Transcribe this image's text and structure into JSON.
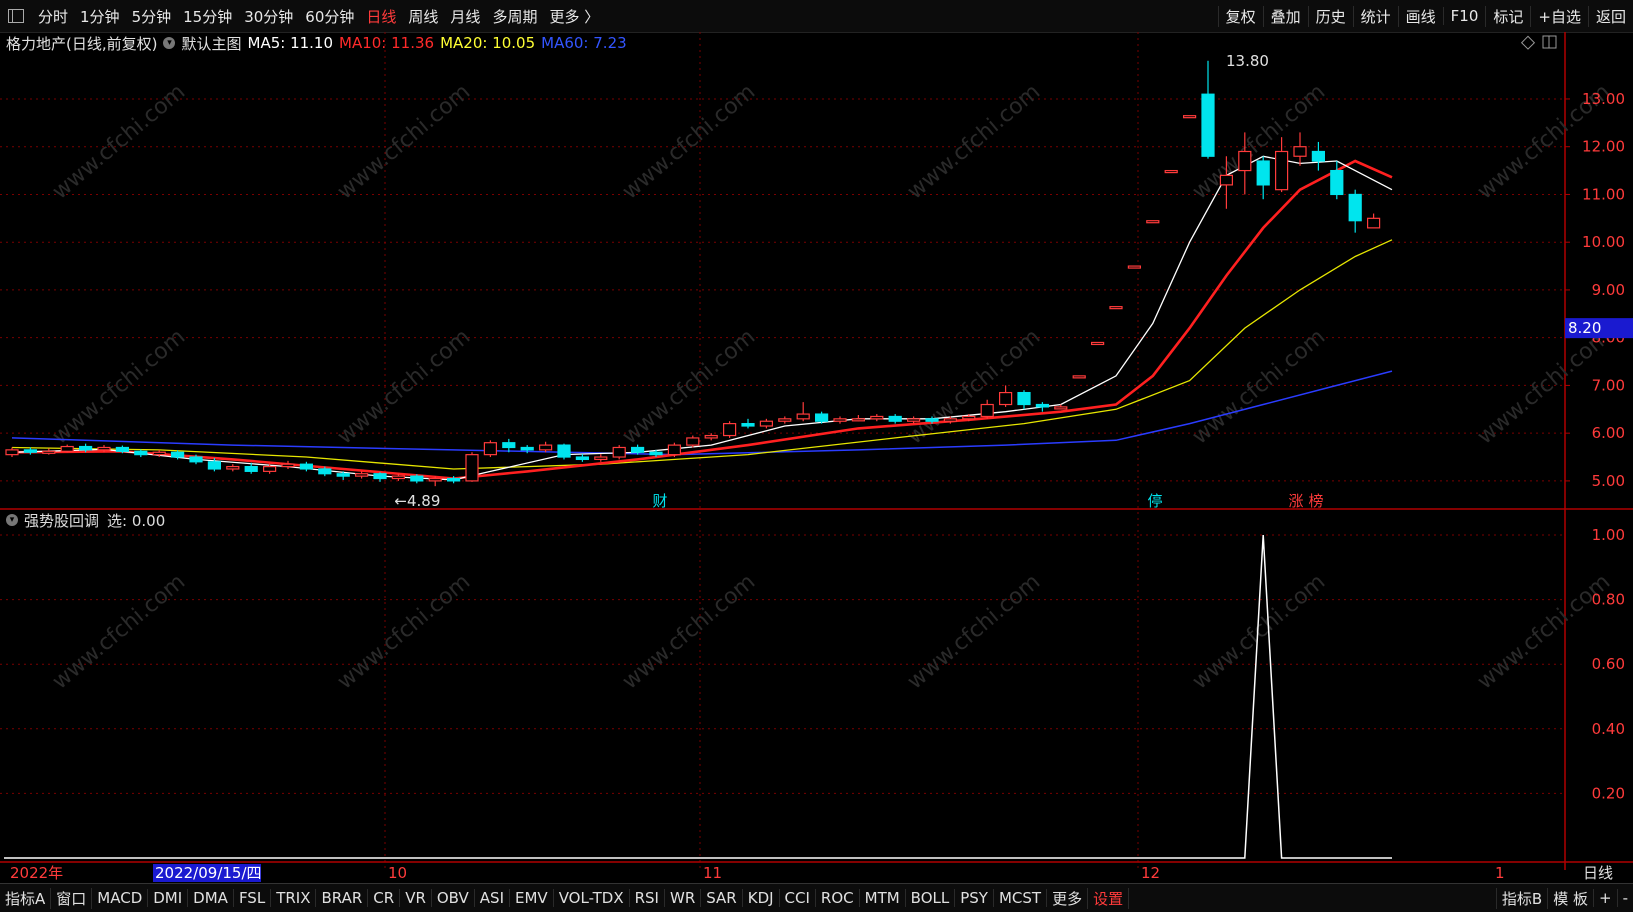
{
  "topbar": {
    "periods": [
      "分时",
      "1分钟",
      "5分钟",
      "15分钟",
      "30分钟",
      "60分钟",
      "日线",
      "周线",
      "月线",
      "多周期",
      "更多 〉"
    ],
    "active_period": "日线",
    "tools": [
      "复权",
      "叠加",
      "历史",
      "统计",
      "画线",
      "F10",
      "标记",
      "+自选",
      "返回"
    ]
  },
  "legend": {
    "title": "格力地产(日线,前复权)",
    "template": "默认主图",
    "ma5": "MA5: 11.10",
    "ma10": "MA10: 11.36",
    "ma20": "MA20: 10.05",
    "ma60": "MA60: 7.23"
  },
  "sub_legend": {
    "title": "强势股回调",
    "value": "选: 0.00"
  },
  "price_axis": {
    "ticks": [
      "13.00",
      "12.00",
      "11.00",
      "10.00",
      "9.00",
      "8.00",
      "7.00",
      "6.00",
      "5.00"
    ],
    "current": "8.20"
  },
  "sub_axis": {
    "ticks": [
      "1.00",
      "0.80",
      "0.60",
      "0.40",
      "0.20"
    ]
  },
  "annotations": {
    "high": "13.80",
    "low": "←4.89",
    "markers": [
      "财",
      "停",
      "涨",
      "榜"
    ]
  },
  "time_axis": {
    "labels": [
      "2022年",
      "2022/09/15/四",
      "10",
      "11",
      "12",
      "1"
    ],
    "period_label": "日线"
  },
  "bottom_tabs": [
    "指标A",
    "窗口",
    "MACD",
    "DMI",
    "DMA",
    "FSL",
    "TRIX",
    "BRAR",
    "CR",
    "VR",
    "OBV",
    "ASI",
    "EMV",
    "VOL-TDX",
    "RSI",
    "WR",
    "SAR",
    "KDJ",
    "CCI",
    "ROC",
    "MTM",
    "BOLL",
    "PSY",
    "MCST",
    "更多",
    "设置"
  ],
  "bottom_right": [
    "指标B",
    "模 板",
    "+",
    "-"
  ],
  "watermark": "www.cfchi.com",
  "colors": {
    "up": "#ff3b3b",
    "down": "#00e5ee",
    "ma5": "#ffffff",
    "ma10": "#ff2020",
    "ma20": "#e6e600",
    "ma60": "#2a3cff",
    "grid": "#7a0000",
    "axis_line": "#b00000"
  },
  "chart_data": {
    "type": "candlestick",
    "price_range": [
      4.6,
      13.9
    ],
    "candles": [
      [
        5.55,
        5.65,
        5.7,
        5.5
      ],
      [
        5.65,
        5.6,
        5.7,
        5.55
      ],
      [
        5.6,
        5.62,
        5.68,
        5.55
      ],
      [
        5.62,
        5.72,
        5.76,
        5.6
      ],
      [
        5.72,
        5.65,
        5.78,
        5.6
      ],
      [
        5.65,
        5.7,
        5.75,
        5.6
      ],
      [
        5.7,
        5.62,
        5.74,
        5.58
      ],
      [
        5.62,
        5.55,
        5.66,
        5.5
      ],
      [
        5.55,
        5.6,
        5.65,
        5.5
      ],
      [
        5.6,
        5.5,
        5.64,
        5.45
      ],
      [
        5.5,
        5.4,
        5.55,
        5.35
      ],
      [
        5.4,
        5.25,
        5.48,
        5.2
      ],
      [
        5.25,
        5.3,
        5.35,
        5.2
      ],
      [
        5.3,
        5.2,
        5.38,
        5.15
      ],
      [
        5.2,
        5.3,
        5.36,
        5.15
      ],
      [
        5.3,
        5.35,
        5.42,
        5.25
      ],
      [
        5.35,
        5.25,
        5.4,
        5.2
      ],
      [
        5.25,
        5.15,
        5.3,
        5.1
      ],
      [
        5.15,
        5.1,
        5.2,
        5.02
      ],
      [
        5.1,
        5.15,
        5.2,
        5.05
      ],
      [
        5.15,
        5.05,
        5.18,
        4.98
      ],
      [
        5.05,
        5.1,
        5.15,
        5.0
      ],
      [
        5.1,
        5.0,
        5.14,
        4.95
      ],
      [
        5.0,
        5.05,
        5.1,
        4.89
      ],
      [
        5.05,
        5.0,
        5.1,
        4.95
      ],
      [
        5.0,
        5.55,
        5.6,
        4.98
      ],
      [
        5.55,
        5.8,
        5.85,
        5.5
      ],
      [
        5.8,
        5.7,
        5.88,
        5.6
      ],
      [
        5.7,
        5.65,
        5.75,
        5.58
      ],
      [
        5.65,
        5.75,
        5.82,
        5.6
      ],
      [
        5.75,
        5.5,
        5.78,
        5.45
      ],
      [
        5.5,
        5.45,
        5.56,
        5.4
      ],
      [
        5.45,
        5.5,
        5.56,
        5.4
      ],
      [
        5.5,
        5.7,
        5.75,
        5.45
      ],
      [
        5.7,
        5.6,
        5.76,
        5.55
      ],
      [
        5.6,
        5.55,
        5.65,
        5.5
      ],
      [
        5.55,
        5.75,
        5.8,
        5.5
      ],
      [
        5.75,
        5.9,
        5.95,
        5.7
      ],
      [
        5.9,
        5.95,
        6.0,
        5.85
      ],
      [
        5.95,
        6.2,
        6.25,
        5.9
      ],
      [
        6.2,
        6.15,
        6.3,
        6.1
      ],
      [
        6.15,
        6.25,
        6.3,
        6.1
      ],
      [
        6.25,
        6.3,
        6.35,
        6.2
      ],
      [
        6.3,
        6.4,
        6.65,
        6.25
      ],
      [
        6.4,
        6.25,
        6.45,
        6.2
      ],
      [
        6.25,
        6.3,
        6.35,
        6.2
      ],
      [
        6.3,
        6.3,
        6.38,
        6.25
      ],
      [
        6.3,
        6.35,
        6.4,
        6.25
      ],
      [
        6.35,
        6.25,
        6.4,
        6.2
      ],
      [
        6.25,
        6.3,
        6.35,
        6.2
      ],
      [
        6.3,
        6.25,
        6.35,
        6.2
      ],
      [
        6.25,
        6.3,
        6.35,
        6.2
      ],
      [
        6.3,
        6.35,
        6.4,
        6.25
      ],
      [
        6.35,
        6.6,
        6.7,
        6.3
      ],
      [
        6.6,
        6.85,
        7.0,
        6.55
      ],
      [
        6.85,
        6.6,
        6.9,
        6.5
      ],
      [
        6.6,
        6.55,
        6.65,
        6.45
      ],
      [
        6.55,
        6.55,
        6.6,
        6.5
      ],
      [
        7.2,
        7.2,
        7.2,
        7.2
      ],
      [
        7.9,
        7.9,
        7.9,
        7.9
      ],
      [
        8.65,
        8.65,
        8.65,
        8.65
      ],
      [
        9.5,
        9.5,
        9.5,
        9.5
      ],
      [
        10.45,
        10.45,
        10.45,
        10.45
      ],
      [
        11.5,
        11.5,
        11.5,
        11.5
      ],
      [
        12.65,
        12.65,
        12.65,
        12.65
      ],
      [
        13.1,
        11.8,
        13.8,
        11.75
      ],
      [
        11.2,
        11.4,
        11.8,
        10.7
      ],
      [
        11.5,
        11.9,
        12.3,
        11.0
      ],
      [
        11.7,
        11.2,
        11.8,
        10.9
      ],
      [
        11.1,
        11.9,
        12.2,
        11.05
      ],
      [
        11.8,
        12.0,
        12.3,
        11.6
      ],
      [
        11.9,
        11.7,
        12.1,
        11.5
      ],
      [
        11.5,
        11.0,
        11.7,
        10.9
      ],
      [
        11.0,
        10.45,
        11.1,
        10.2
      ],
      [
        10.3,
        10.5,
        10.6,
        10.3
      ]
    ],
    "ma5": [
      [
        0,
        5.6
      ],
      [
        5,
        5.66
      ],
      [
        10,
        5.45
      ],
      [
        15,
        5.3
      ],
      [
        20,
        5.1
      ],
      [
        24,
        5.02
      ],
      [
        26,
        5.2
      ],
      [
        30,
        5.55
      ],
      [
        34,
        5.6
      ],
      [
        38,
        5.75
      ],
      [
        42,
        6.15
      ],
      [
        46,
        6.3
      ],
      [
        50,
        6.3
      ],
      [
        54,
        6.45
      ],
      [
        57,
        6.6
      ],
      [
        60,
        7.2
      ],
      [
        62,
        8.3
      ],
      [
        64,
        10.0
      ],
      [
        66,
        11.4
      ],
      [
        68,
        11.8
      ],
      [
        70,
        11.65
      ],
      [
        72,
        11.7
      ],
      [
        75,
        11.1
      ]
    ],
    "ma10": [
      [
        0,
        5.6
      ],
      [
        6,
        5.62
      ],
      [
        12,
        5.45
      ],
      [
        18,
        5.25
      ],
      [
        24,
        5.05
      ],
      [
        28,
        5.2
      ],
      [
        34,
        5.45
      ],
      [
        40,
        5.75
      ],
      [
        46,
        6.1
      ],
      [
        52,
        6.28
      ],
      [
        57,
        6.45
      ],
      [
        60,
        6.6
      ],
      [
        62,
        7.2
      ],
      [
        64,
        8.2
      ],
      [
        66,
        9.3
      ],
      [
        68,
        10.3
      ],
      [
        70,
        11.1
      ],
      [
        73,
        11.7
      ],
      [
        75,
        11.36
      ]
    ],
    "ma20": [
      [
        0,
        5.7
      ],
      [
        8,
        5.65
      ],
      [
        16,
        5.5
      ],
      [
        24,
        5.25
      ],
      [
        32,
        5.35
      ],
      [
        40,
        5.55
      ],
      [
        48,
        5.9
      ],
      [
        55,
        6.2
      ],
      [
        60,
        6.5
      ],
      [
        64,
        7.1
      ],
      [
        67,
        8.2
      ],
      [
        70,
        9.0
      ],
      [
        73,
        9.7
      ],
      [
        75,
        10.05
      ]
    ],
    "ma60": [
      [
        0,
        5.9
      ],
      [
        12,
        5.75
      ],
      [
        24,
        5.65
      ],
      [
        36,
        5.55
      ],
      [
        46,
        5.65
      ],
      [
        54,
        5.75
      ],
      [
        60,
        5.85
      ],
      [
        64,
        6.2
      ],
      [
        68,
        6.6
      ],
      [
        72,
        7.0
      ],
      [
        75,
        7.3
      ]
    ],
    "signal": [
      [
        0,
        0
      ],
      [
        67,
        0
      ],
      [
        68,
        1.0
      ],
      [
        69,
        0
      ],
      [
        75,
        0
      ]
    ]
  }
}
